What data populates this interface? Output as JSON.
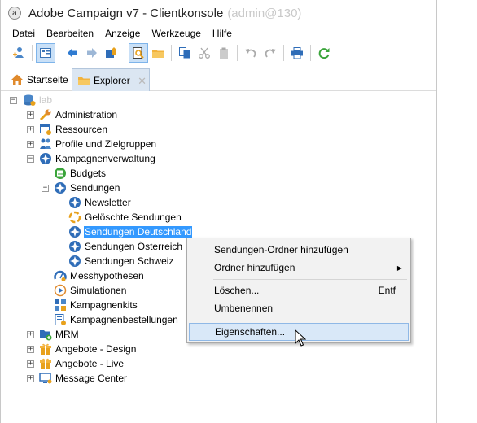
{
  "window": {
    "title": "Adobe Campaign v7 - Clientkonsole",
    "user": "(admin@130)"
  },
  "menu": [
    "Datei",
    "Bearbeiten",
    "Anzeige",
    "Werkzeuge",
    "Hilfe"
  ],
  "tabs": {
    "home": "Startseite",
    "explorer": "Explorer",
    "close": "✕"
  },
  "tree": {
    "root": "lab",
    "administration": "Administration",
    "resources": "Ressourcen",
    "profiles": "Profile und Zielgruppen",
    "campaign_mgmt": "Kampagnenverwaltung",
    "budgets": "Budgets",
    "deliveries": "Sendungen",
    "newsletter": "Newsletter",
    "deleted_deliveries": "Gelöschte Sendungen",
    "deliveries_de": "Sendungen Deutschland",
    "deliveries_at": "Sendungen Österreich",
    "deliveries_ch": "Sendungen Schweiz",
    "hypotheses": "Messhypothesen",
    "simulations": "Simulationen",
    "campaign_kits": "Kampagnenkits",
    "campaign_orders": "Kampagnenbestellungen",
    "mrm": "MRM",
    "offers_design": "Angebote - Design",
    "offers_live": "Angebote - Live",
    "message_center": "Message Center"
  },
  "context_menu": {
    "add_delivery_folder": "Sendungen-Ordner hinzufügen",
    "add_folder": "Ordner hinzufügen",
    "delete": "Löschen...",
    "delete_shortcut": "Entf",
    "rename": "Umbenennen",
    "properties": "Eigenschaften..."
  },
  "colors": {
    "selection": "#3399ff",
    "hover": "#d9e8f8",
    "tab_active": "#dbe6f2"
  }
}
